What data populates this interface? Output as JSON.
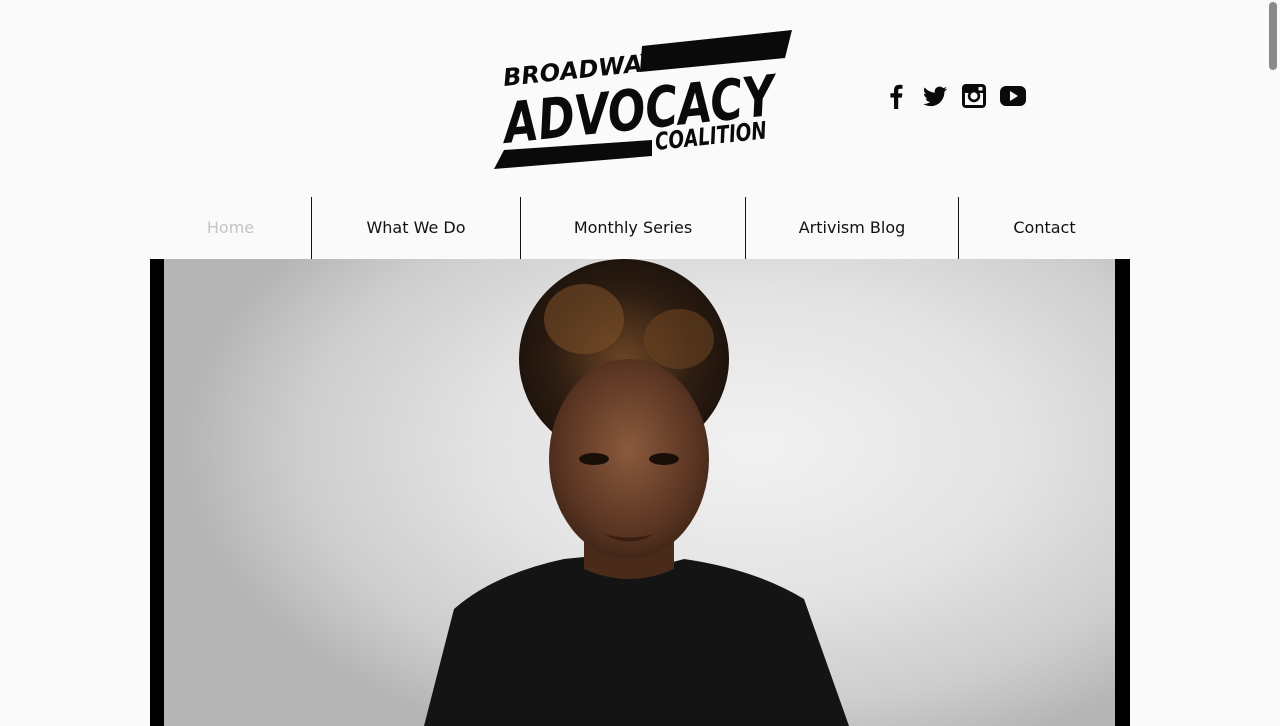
{
  "logo": {
    "line1": "BROADWAY",
    "line2": "ADVOCACY",
    "line3": "COALITION"
  },
  "social": [
    {
      "name": "facebook-icon"
    },
    {
      "name": "twitter-icon"
    },
    {
      "name": "instagram-icon"
    },
    {
      "name": "youtube-icon"
    }
  ],
  "nav": {
    "items": [
      {
        "label": "Home",
        "active": true
      },
      {
        "label": "What We Do",
        "active": false
      },
      {
        "label": "Monthly Series",
        "active": false
      },
      {
        "label": "Artivism Blog",
        "active": false
      },
      {
        "label": "Contact",
        "active": false
      }
    ]
  },
  "colors": {
    "background": "#fafafa",
    "text": "#111111",
    "nav_active": "#c4c4c4",
    "logo": "#0a0a0a"
  }
}
